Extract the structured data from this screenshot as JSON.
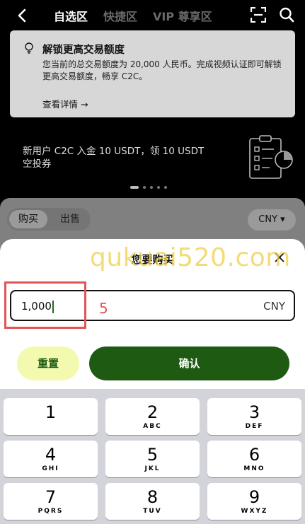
{
  "nav": {
    "tabs": [
      "自选区",
      "快捷区",
      "VIP 尊享区"
    ]
  },
  "notice": {
    "title": "解锁更高交易额度",
    "description": "您当前的总交易额度为 20,000 人民币。完成视频认证即可解锁更高交易额度，畅享 C2C。",
    "link": "查看详情 →"
  },
  "promo": {
    "text": "新用户 C2C 入金 10 USDT，领 10 USDT 空投券"
  },
  "market": {
    "buy_label": "购买",
    "sell_label": "出售",
    "currency_select": "CNY ▾"
  },
  "modal": {
    "title": "您要购买",
    "amount_value": "1,000",
    "amount_currency": "CNY",
    "step_label": "5",
    "reset_label": "重置",
    "confirm_label": "确认"
  },
  "watermark": "qukuai520.com",
  "keypad": [
    {
      "digit": "1",
      "letters": ""
    },
    {
      "digit": "2",
      "letters": "ABC"
    },
    {
      "digit": "3",
      "letters": "DEF"
    },
    {
      "digit": "4",
      "letters": "GHI"
    },
    {
      "digit": "5",
      "letters": "JKL"
    },
    {
      "digit": "6",
      "letters": "MNO"
    },
    {
      "digit": "7",
      "letters": "PQRS"
    },
    {
      "digit": "8",
      "letters": "TUV"
    },
    {
      "digit": "9",
      "letters": "WXYZ"
    }
  ],
  "colors": {
    "accent_green": "#1f5a12",
    "reset_bg": "#f4f9b0",
    "annotation_red": "#e05555",
    "watermark_yellow": "#f0d14a"
  }
}
